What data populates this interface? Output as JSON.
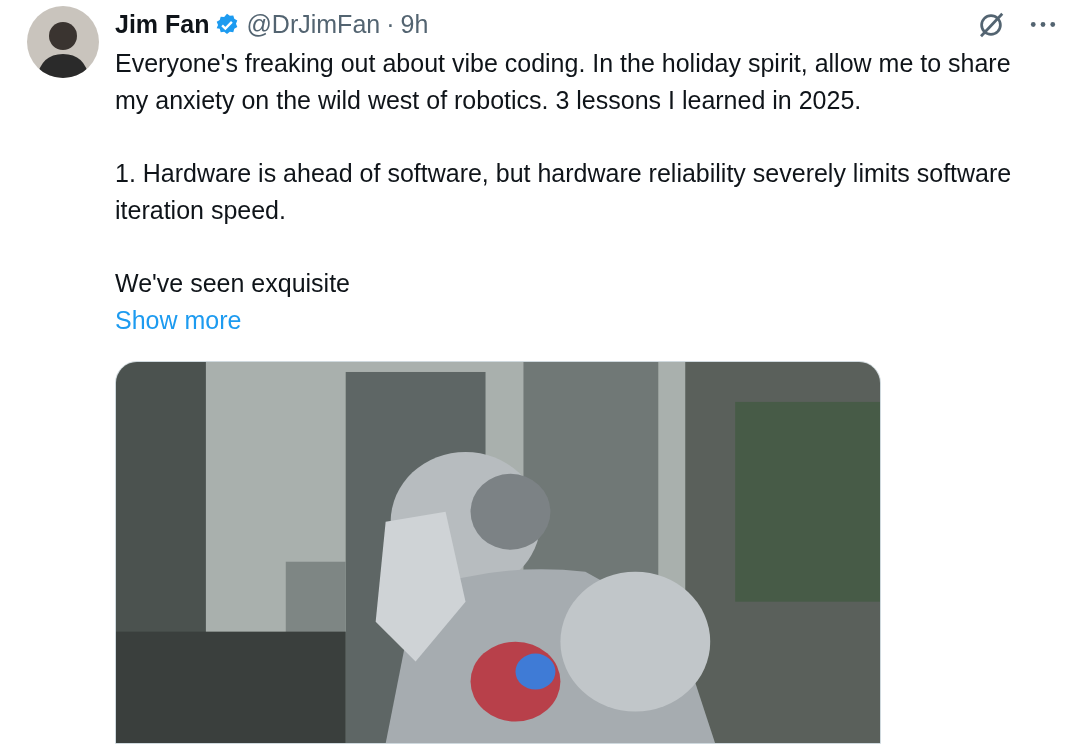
{
  "tweet": {
    "author": {
      "name": "Jim Fan",
      "verified": true,
      "handle": "@DrJimFan",
      "separator": "·",
      "time": "9h"
    },
    "paragraphs": [
      "Everyone's freaking out about vibe coding. In the holiday spirit, allow me to share my anxiety on the wild west of robotics. 3 lessons I learned in 2025.",
      "1. Hardware is ahead of software, but hardware reliability severely limits software iteration speed.",
      "We've seen exquisite"
    ],
    "show_more": "Show more"
  }
}
